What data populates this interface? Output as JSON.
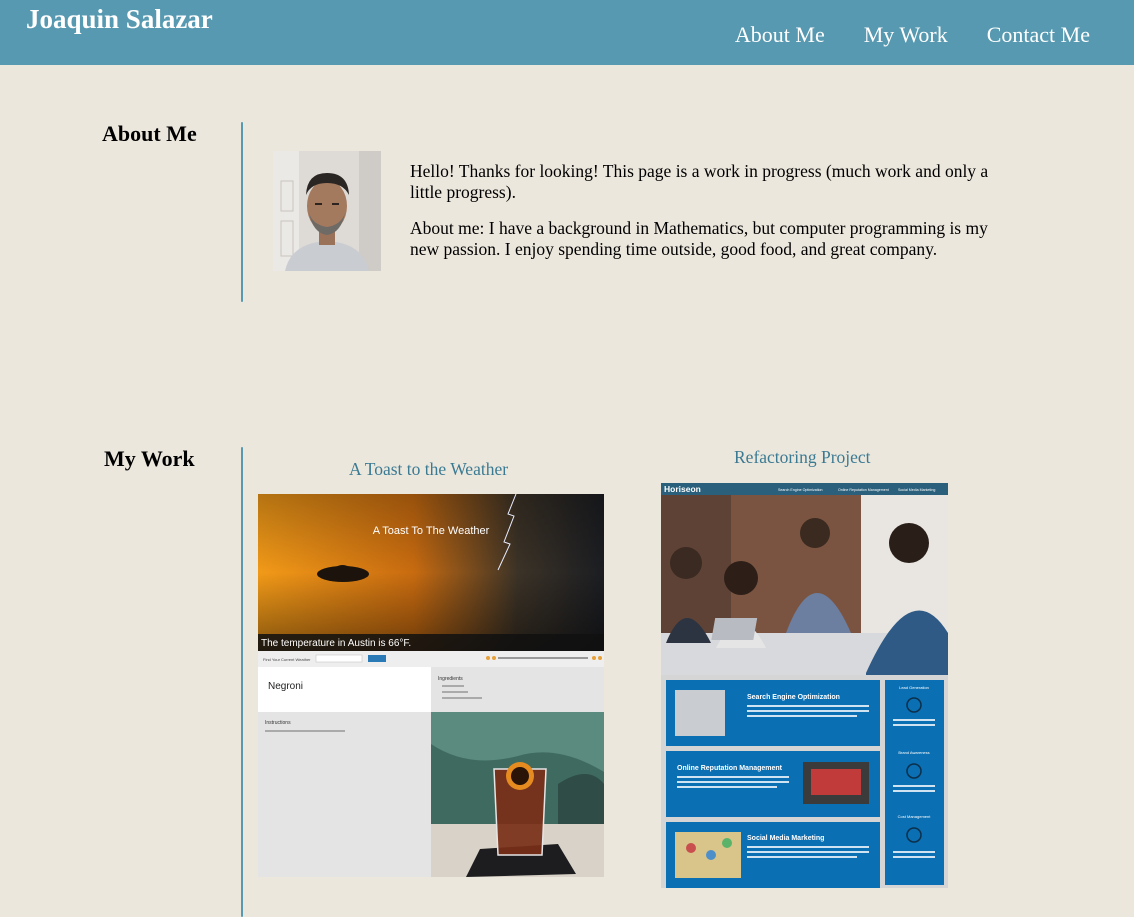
{
  "header": {
    "title": "Joaquin Salazar",
    "nav": [
      "About Me",
      "My Work",
      "Contact Me"
    ]
  },
  "about": {
    "heading": "About Me",
    "paragraphs": [
      "Hello! Thanks for looking! This page is a work in progress (much work and only a little progress).",
      "About me: I have a background in Mathematics, but computer programming is my new passion. I enjoy spending time outside, good food, and great company."
    ]
  },
  "work": {
    "heading": "My Work",
    "projects": [
      {
        "title": "A Toast to the Weather",
        "screenshot": {
          "hero_title": "A Toast To The Weather",
          "temperature_text": "The temperature in Austin is 66°F.",
          "search_label": "Find Your Current Weather",
          "search_placeholder": "Austin",
          "search_button": "search",
          "drink_name": "Negroni",
          "ingredients_label": "Ingredients",
          "instructions_label": "Instructions"
        }
      },
      {
        "title": "Refactoring Project",
        "screenshot": {
          "brand": "Horiseon",
          "nav": [
            "Search Engine Optimization",
            "Online Reputation Management",
            "Social Media Marketing"
          ],
          "cards": [
            "Search Engine Optimization",
            "Online Reputation Management",
            "Social Media Marketing"
          ],
          "sidebar": [
            "Lead Generation",
            "Brand Awareness",
            "Cost Management"
          ]
        }
      }
    ]
  },
  "colors": {
    "header": "#5799b1",
    "background": "#ece7dd",
    "link": "#3b7a93",
    "accent_line": "#5799b1"
  }
}
